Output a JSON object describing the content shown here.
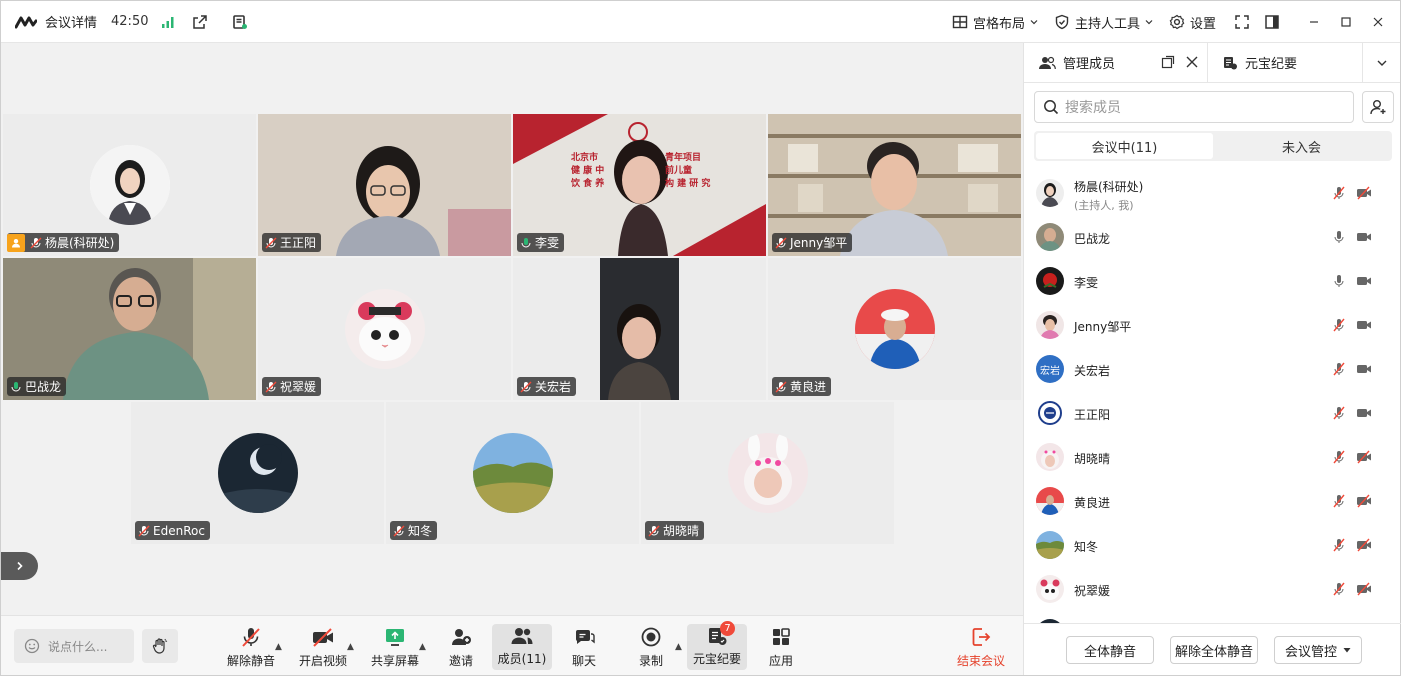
{
  "topbar": {
    "meeting_details": "会议详情",
    "timer": "42:50",
    "layout_label": "宫格布局",
    "host_tools_label": "主持人工具",
    "settings_label": "设置"
  },
  "tiles": [
    {
      "name": "杨晨(科研处)",
      "host": true
    },
    {
      "name": "王正阳",
      "host": false
    },
    {
      "name": "李雯",
      "host": false
    },
    {
      "name": "Jenny邹平",
      "host": false
    },
    {
      "name": "巴战龙",
      "host": false
    },
    {
      "name": "祝翠媛",
      "host": false
    },
    {
      "name": "关宏岩",
      "host": false
    },
    {
      "name": "黄良进",
      "host": false
    },
    {
      "name": "EdenRoc",
      "host": false
    },
    {
      "name": "知冬",
      "host": false
    },
    {
      "name": "胡晓晴",
      "host": false
    }
  ],
  "banner": {
    "line1": "北京市",
    "line1b": "青年项目",
    "line2": "健 康 中",
    "line2b": "前儿童",
    "line3": "饮 食 养",
    "line3b": "构 建 研 究"
  },
  "toolbar": {
    "chat_placeholder": "说点什么...",
    "unmute": "解除静音",
    "start_video": "开启视频",
    "share_screen": "共享屏幕",
    "invite": "邀请",
    "members": "成员(11)",
    "chat": "聊天",
    "record": "录制",
    "yuanbao": "元宝纪要",
    "yuanbao_badge": "7",
    "apps": "应用",
    "end_meeting": "结束会议"
  },
  "panel": {
    "tab_members": "管理成员",
    "tab_yuanbao": "元宝纪要",
    "search_placeholder": "搜索成员",
    "seg_in_meeting": "会议中(11)",
    "seg_not_joined": "未入会",
    "members": [
      {
        "name": "杨晨(科研处)",
        "sub": "(主持人, 我)",
        "mic": "muted",
        "cam": "off"
      },
      {
        "name": "巴战龙",
        "sub": "",
        "mic": "on",
        "cam": "on"
      },
      {
        "name": "李雯",
        "sub": "",
        "mic": "on",
        "cam": "on"
      },
      {
        "name": "Jenny邹平",
        "sub": "",
        "mic": "muted",
        "cam": "on"
      },
      {
        "name": "关宏岩",
        "sub": "",
        "mic": "muted",
        "cam": "on"
      },
      {
        "name": "王正阳",
        "sub": "",
        "mic": "muted",
        "cam": "on"
      },
      {
        "name": "胡晓晴",
        "sub": "",
        "mic": "muted",
        "cam": "off"
      },
      {
        "name": "黄良进",
        "sub": "",
        "mic": "muted",
        "cam": "off"
      },
      {
        "name": "知冬",
        "sub": "",
        "mic": "muted",
        "cam": "off"
      },
      {
        "name": "祝翠媛",
        "sub": "",
        "mic": "muted",
        "cam": "off"
      }
    ],
    "avatar_text_guan": "宏岩",
    "mute_all": "全体静音",
    "unmute_all": "解除全体静音",
    "meeting_control": "会议管控"
  },
  "colors": {
    "accent_green": "#2bb673",
    "end_red": "#e5432d",
    "badge_red": "#f04a3a",
    "host_orange": "#f7a31c"
  }
}
